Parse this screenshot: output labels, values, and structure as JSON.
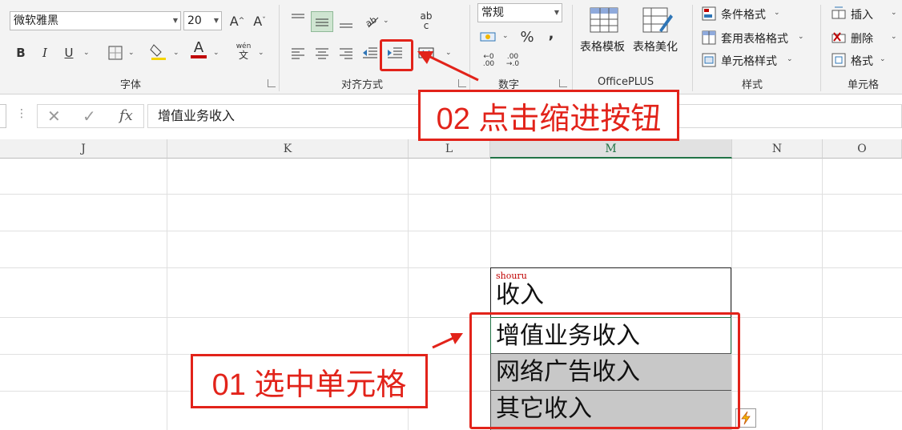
{
  "ribbon": {
    "font": {
      "font_name": "微软雅黑",
      "font_size": "20",
      "grow_glyph": "A",
      "shrink_glyph": "A",
      "bold": "B",
      "italic": "I",
      "underline": "U",
      "font_color_glyph": "A",
      "phonetic_top": "wén",
      "phonetic_bottom": "文",
      "group_label": "字体"
    },
    "alignment": {
      "wrap_glyph_top": "ab",
      "wrap_glyph_bottom": "c",
      "group_label": "对齐方式"
    },
    "number": {
      "format": "常规",
      "percent": "%",
      "comma": ",",
      "inc_decimal": "←0\n.00",
      "dec_decimal": ".00\n→.0",
      "group_label": "数字"
    },
    "officeplus": {
      "table_template": "表格模板",
      "table_beautify": "表格美化",
      "group_label": "OfficePLUS"
    },
    "styles": {
      "conditional_format": "条件格式",
      "format_as_table": "套用表格格式",
      "cell_styles": "单元格样式",
      "group_label": "样式"
    },
    "cells": {
      "insert": "插入",
      "delete": "删除",
      "format": "格式",
      "group_label": "单元格"
    }
  },
  "formula_bar": {
    "fx": "fx",
    "value": "增值业务收入"
  },
  "columns": [
    "J",
    "K",
    "L",
    "M",
    "N",
    "O"
  ],
  "cells": {
    "m_phonetic": "shouru",
    "m_header": "收入",
    "m_rows": [
      "增值业务收入",
      "网络广告收入",
      "其它收入"
    ]
  },
  "annotations": {
    "step1": "01 选中单元格",
    "step2": "02 点击缩进按钮"
  },
  "colors": {
    "annotation": "#e2231a",
    "excel_green": "#217346",
    "selection_fill": "#c8c8c8"
  }
}
